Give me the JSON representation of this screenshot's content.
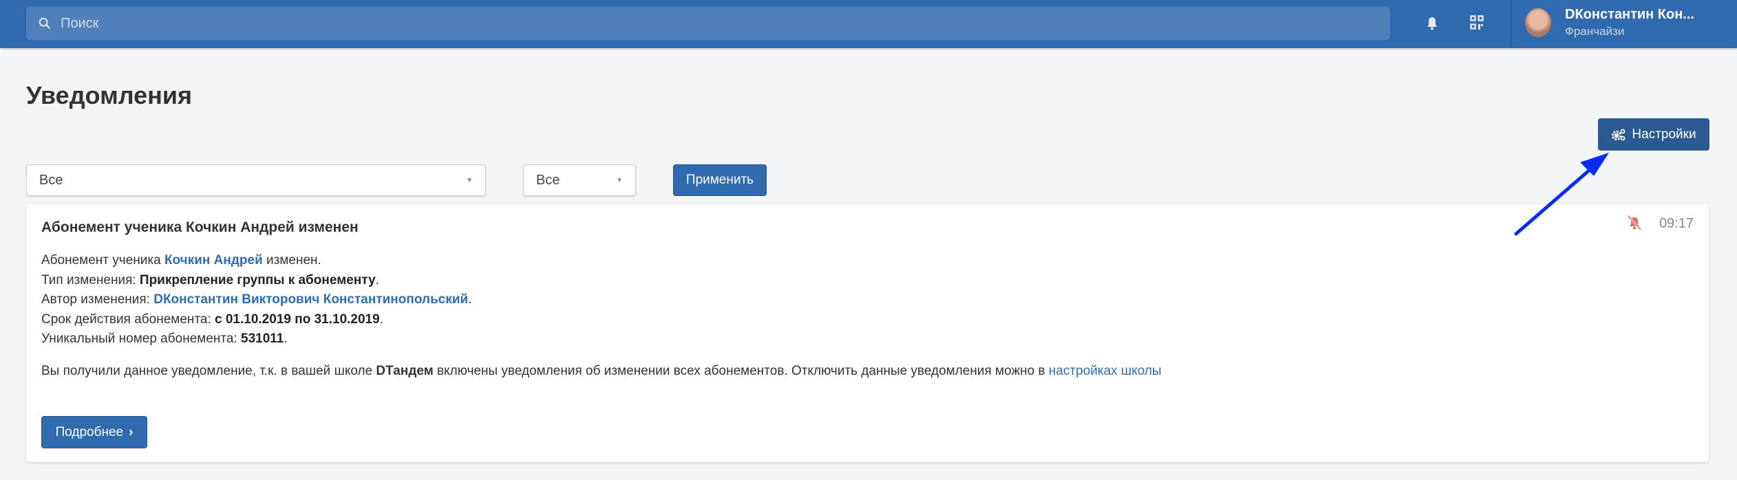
{
  "header": {
    "search_placeholder": "Поиск",
    "user_name": "DКонстантин Кон...",
    "user_role": "Франчайзи",
    "icons": [
      "search-icon",
      "bell-icon",
      "qr-code-icon"
    ]
  },
  "page": {
    "title": "Уведомления",
    "settings_label": "Настройки"
  },
  "filters": {
    "type_value": "Все",
    "status_value": "Все",
    "apply_label": "Применить"
  },
  "notification": {
    "title": "Абонемент ученика Кочкин Андрей изменен",
    "time": "09:17",
    "line1_prefix": "Абонемент ученика ",
    "student": "Кочкин Андрей",
    "line1_suffix": " изменен.",
    "line2_label": "Тип изменения: ",
    "change_type": "Прикрепление группы к абонементу",
    "line3_label": "Автор изменения: ",
    "author": "DКонстантин Викторович Константинопольский",
    "line4_label": "Срок действия абонемента: ",
    "period": "с 01.10.2019 по 31.10.2019",
    "line5_label": "Уникальный номер абонемента: ",
    "number": "531011",
    "note_prefix": "Вы получили данное уведомление, т.к. в вашей школе ",
    "school": "DТандем",
    "note_middle": " включены уведомления об изменении всех абонементов. Отключить данные уведомления можно в ",
    "note_link": "настройках школы",
    "more_label": "Подробнее",
    "dot": ".",
    "mute_color": "#e8695a"
  },
  "annotation": {
    "arrow_color": "#0a2cff"
  }
}
